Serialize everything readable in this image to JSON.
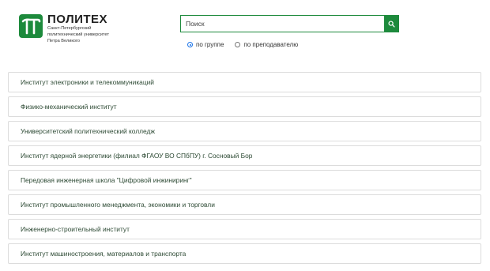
{
  "logo": {
    "title": "ПОЛИТЕХ",
    "sub1": "Санкт-Петербургский",
    "sub2": "политехнический университет",
    "sub3": "Петра Великого"
  },
  "search": {
    "placeholder": "Поиск",
    "button_icon": "search-icon"
  },
  "filter": {
    "options": [
      {
        "label": "по группе",
        "checked": true
      },
      {
        "label": "по преподавателю",
        "checked": false
      }
    ]
  },
  "institutes": [
    {
      "label": "Институт электроники и телекоммуникаций"
    },
    {
      "label": "Физико-механический институт"
    },
    {
      "label": "Университетский политехнический колледж"
    },
    {
      "label": "Институт ядерной энергетики (филиал ФГАОУ ВО СПбПУ) г. Сосновый Бор"
    },
    {
      "label": "Передовая инженерная школа \"Цифровой инжиниринг\""
    },
    {
      "label": "Институт промышленного менеджмента, экономики и торговли"
    },
    {
      "label": "Инженерно-строительный институт"
    },
    {
      "label": "Институт машиностроения, материалов и транспорта"
    }
  ],
  "colors": {
    "brand": "#1d8a3c",
    "item_text": "#2d4a34",
    "item_border": "#dcdcdc"
  }
}
